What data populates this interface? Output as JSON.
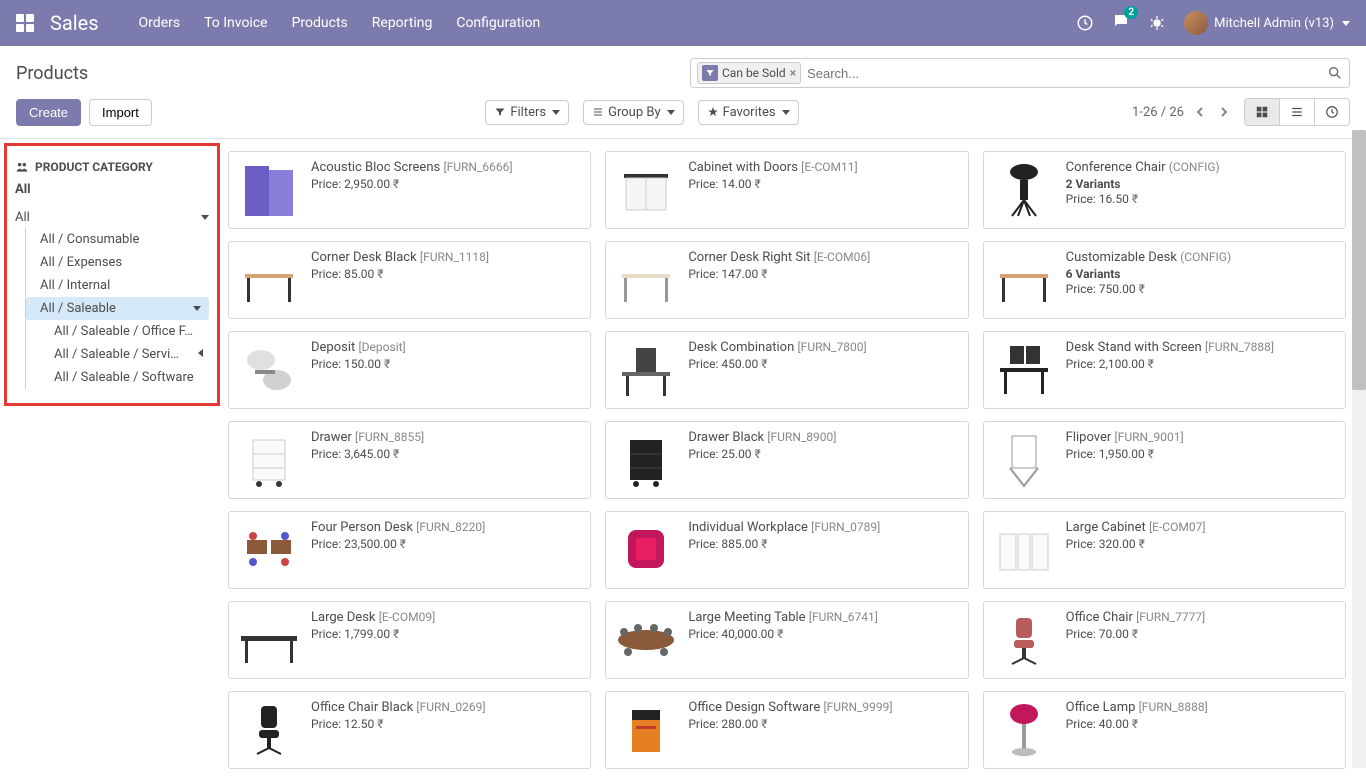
{
  "nav": {
    "brand": "Sales",
    "menu": [
      "Orders",
      "To Invoice",
      "Products",
      "Reporting",
      "Configuration"
    ],
    "chat_badge": "2",
    "user_name": "Mitchell Admin (v13)"
  },
  "control": {
    "title": "Products",
    "search_facet": "Can be Sold",
    "search_placeholder": "Search...",
    "btn_create": "Create",
    "btn_import": "Import",
    "filters": "Filters",
    "groupby": "Group By",
    "favorites": "Favorites",
    "pager": "1-26 / 26"
  },
  "sidebar": {
    "title": "PRODUCT CATEGORY",
    "all": "All",
    "root": "All",
    "items": [
      {
        "label": "All / Consumable"
      },
      {
        "label": "All / Expenses"
      },
      {
        "label": "All / Internal"
      },
      {
        "label": "All / Saleable",
        "selected": true,
        "children": [
          "All / Saleable / Office F…",
          "All / Saleable / Servi…",
          "All / Saleable / Software"
        ]
      }
    ]
  },
  "products": [
    {
      "name": "Acoustic Bloc Screens",
      "ref": "[FURN_6666]",
      "price": "2,950.00",
      "img": "screens"
    },
    {
      "name": "Cabinet with Doors",
      "ref": "[E-COM11]",
      "price": "14.00",
      "img": "cabinet"
    },
    {
      "name": "Conference Chair",
      "ref": "(CONFIG)",
      "price": "16.50",
      "variants": "2 Variants",
      "img": "chair-conf"
    },
    {
      "name": "Corner Desk Black",
      "ref": "[FURN_1118]",
      "price": "85.00",
      "img": "desk-black"
    },
    {
      "name": "Corner Desk Right Sit",
      "ref": "[E-COM06]",
      "price": "147.00",
      "img": "desk-right"
    },
    {
      "name": "Customizable Desk",
      "ref": "(CONFIG)",
      "price": "750.00",
      "variants": "6 Variants",
      "img": "desk-custom"
    },
    {
      "name": "Deposit",
      "ref": "[Deposit]",
      "price": "150.00",
      "img": "deposit"
    },
    {
      "name": "Desk Combination",
      "ref": "[FURN_7800]",
      "price": "450.00",
      "img": "desk-combo"
    },
    {
      "name": "Desk Stand with Screen",
      "ref": "[FURN_7888]",
      "price": "2,100.00",
      "img": "desk-stand"
    },
    {
      "name": "Drawer",
      "ref": "[FURN_8855]",
      "price": "3,645.00",
      "img": "drawer-white"
    },
    {
      "name": "Drawer Black",
      "ref": "[FURN_8900]",
      "price": "25.00",
      "img": "drawer-black"
    },
    {
      "name": "Flipover",
      "ref": "[FURN_9001]",
      "price": "1,950.00",
      "img": "flipover"
    },
    {
      "name": "Four Person Desk",
      "ref": "[FURN_8220]",
      "price": "23,500.00",
      "img": "four-desk"
    },
    {
      "name": "Individual Workplace",
      "ref": "[FURN_0789]",
      "price": "885.00",
      "img": "workplace"
    },
    {
      "name": "Large Cabinet",
      "ref": "[E-COM07]",
      "price": "320.00",
      "img": "large-cabinet"
    },
    {
      "name": "Large Desk",
      "ref": "[E-COM09]",
      "price": "1,799.00",
      "img": "large-desk"
    },
    {
      "name": "Large Meeting Table",
      "ref": "[FURN_6741]",
      "price": "40,000.00",
      "img": "meeting-table"
    },
    {
      "name": "Office Chair",
      "ref": "[FURN_7777]",
      "price": "70.00",
      "img": "office-chair"
    },
    {
      "name": "Office Chair Black",
      "ref": "[FURN_0269]",
      "price": "12.50",
      "img": "office-chair-black"
    },
    {
      "name": "Office Design Software",
      "ref": "[FURN_9999]",
      "price": "280.00",
      "img": "software"
    },
    {
      "name": "Office Lamp",
      "ref": "[FURN_8888]",
      "price": "40.00",
      "img": "lamp"
    }
  ],
  "price_prefix": "Price: "
}
